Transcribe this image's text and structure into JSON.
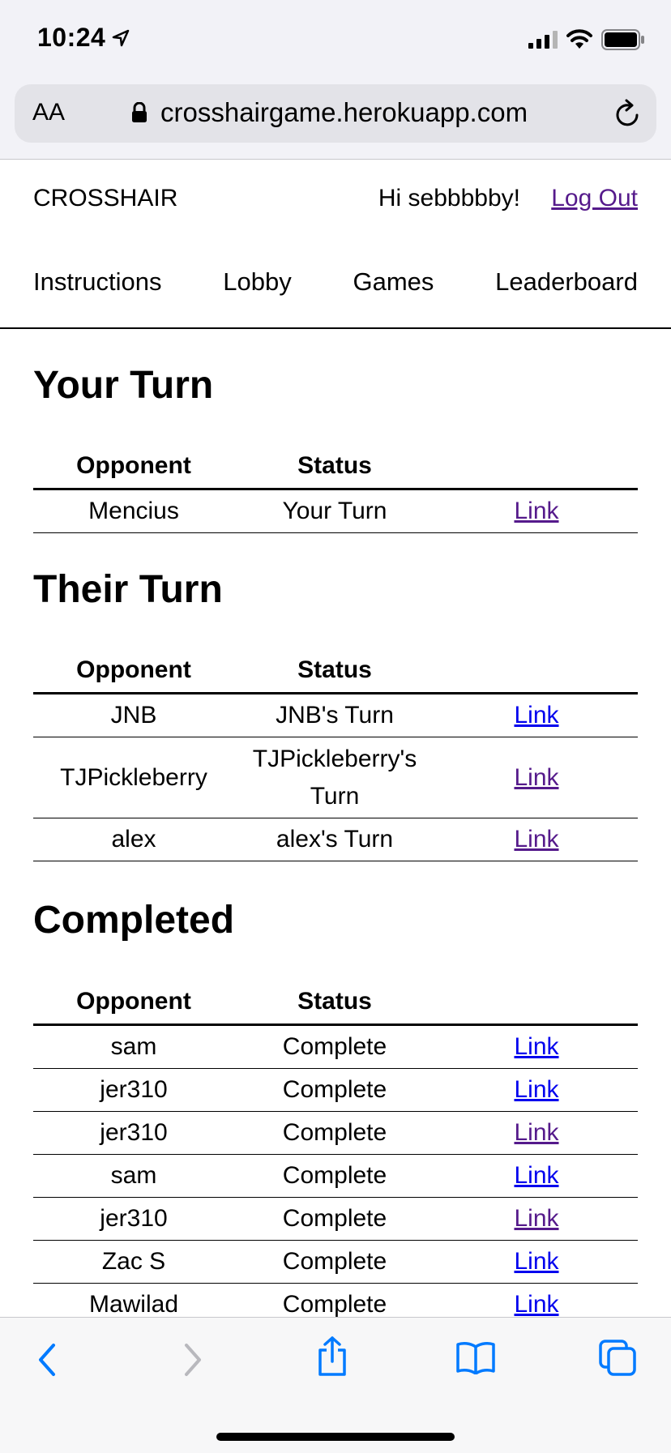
{
  "status_bar": {
    "time": "10:24"
  },
  "browser": {
    "text_size_label": "AA",
    "url": "crosshairgame.herokuapp.com"
  },
  "site": {
    "brand": "CROSSHAIR",
    "greeting": "Hi sebbbbby!",
    "logout_label": "Log Out",
    "nav": [
      "Instructions",
      "Lobby",
      "Games",
      "Leaderboard"
    ]
  },
  "columns": {
    "opponent": "Opponent",
    "status": "Status"
  },
  "link_label": "Link",
  "sections": {
    "your_turn": {
      "title": "Your Turn",
      "rows": [
        {
          "opponent": "Mencius",
          "status": "Your Turn"
        }
      ]
    },
    "their_turn": {
      "title": "Their Turn",
      "rows": [
        {
          "opponent": "JNB",
          "status": "JNB's Turn"
        },
        {
          "opponent": "TJPickleberry",
          "status": "TJPickleberry's Turn"
        },
        {
          "opponent": "alex",
          "status": "alex's Turn"
        }
      ]
    },
    "completed": {
      "title": "Completed",
      "rows": [
        {
          "opponent": "sam",
          "status": "Complete"
        },
        {
          "opponent": "jer310",
          "status": "Complete"
        },
        {
          "opponent": "jer310",
          "status": "Complete"
        },
        {
          "opponent": "sam",
          "status": "Complete"
        },
        {
          "opponent": "jer310",
          "status": "Complete"
        },
        {
          "opponent": "Zac S",
          "status": "Complete"
        },
        {
          "opponent": "Mawilad",
          "status": "Complete"
        }
      ]
    }
  },
  "colors": {
    "visited_link": "#551a8b",
    "link": "#0000ee",
    "ios_blue": "#007aff"
  },
  "icons": [
    "location-arrow-icon",
    "signal-icon",
    "wifi-icon",
    "battery-icon",
    "lock-icon",
    "reload-icon",
    "back-icon",
    "forward-icon",
    "share-icon",
    "bookmarks-icon",
    "tabs-icon"
  ]
}
